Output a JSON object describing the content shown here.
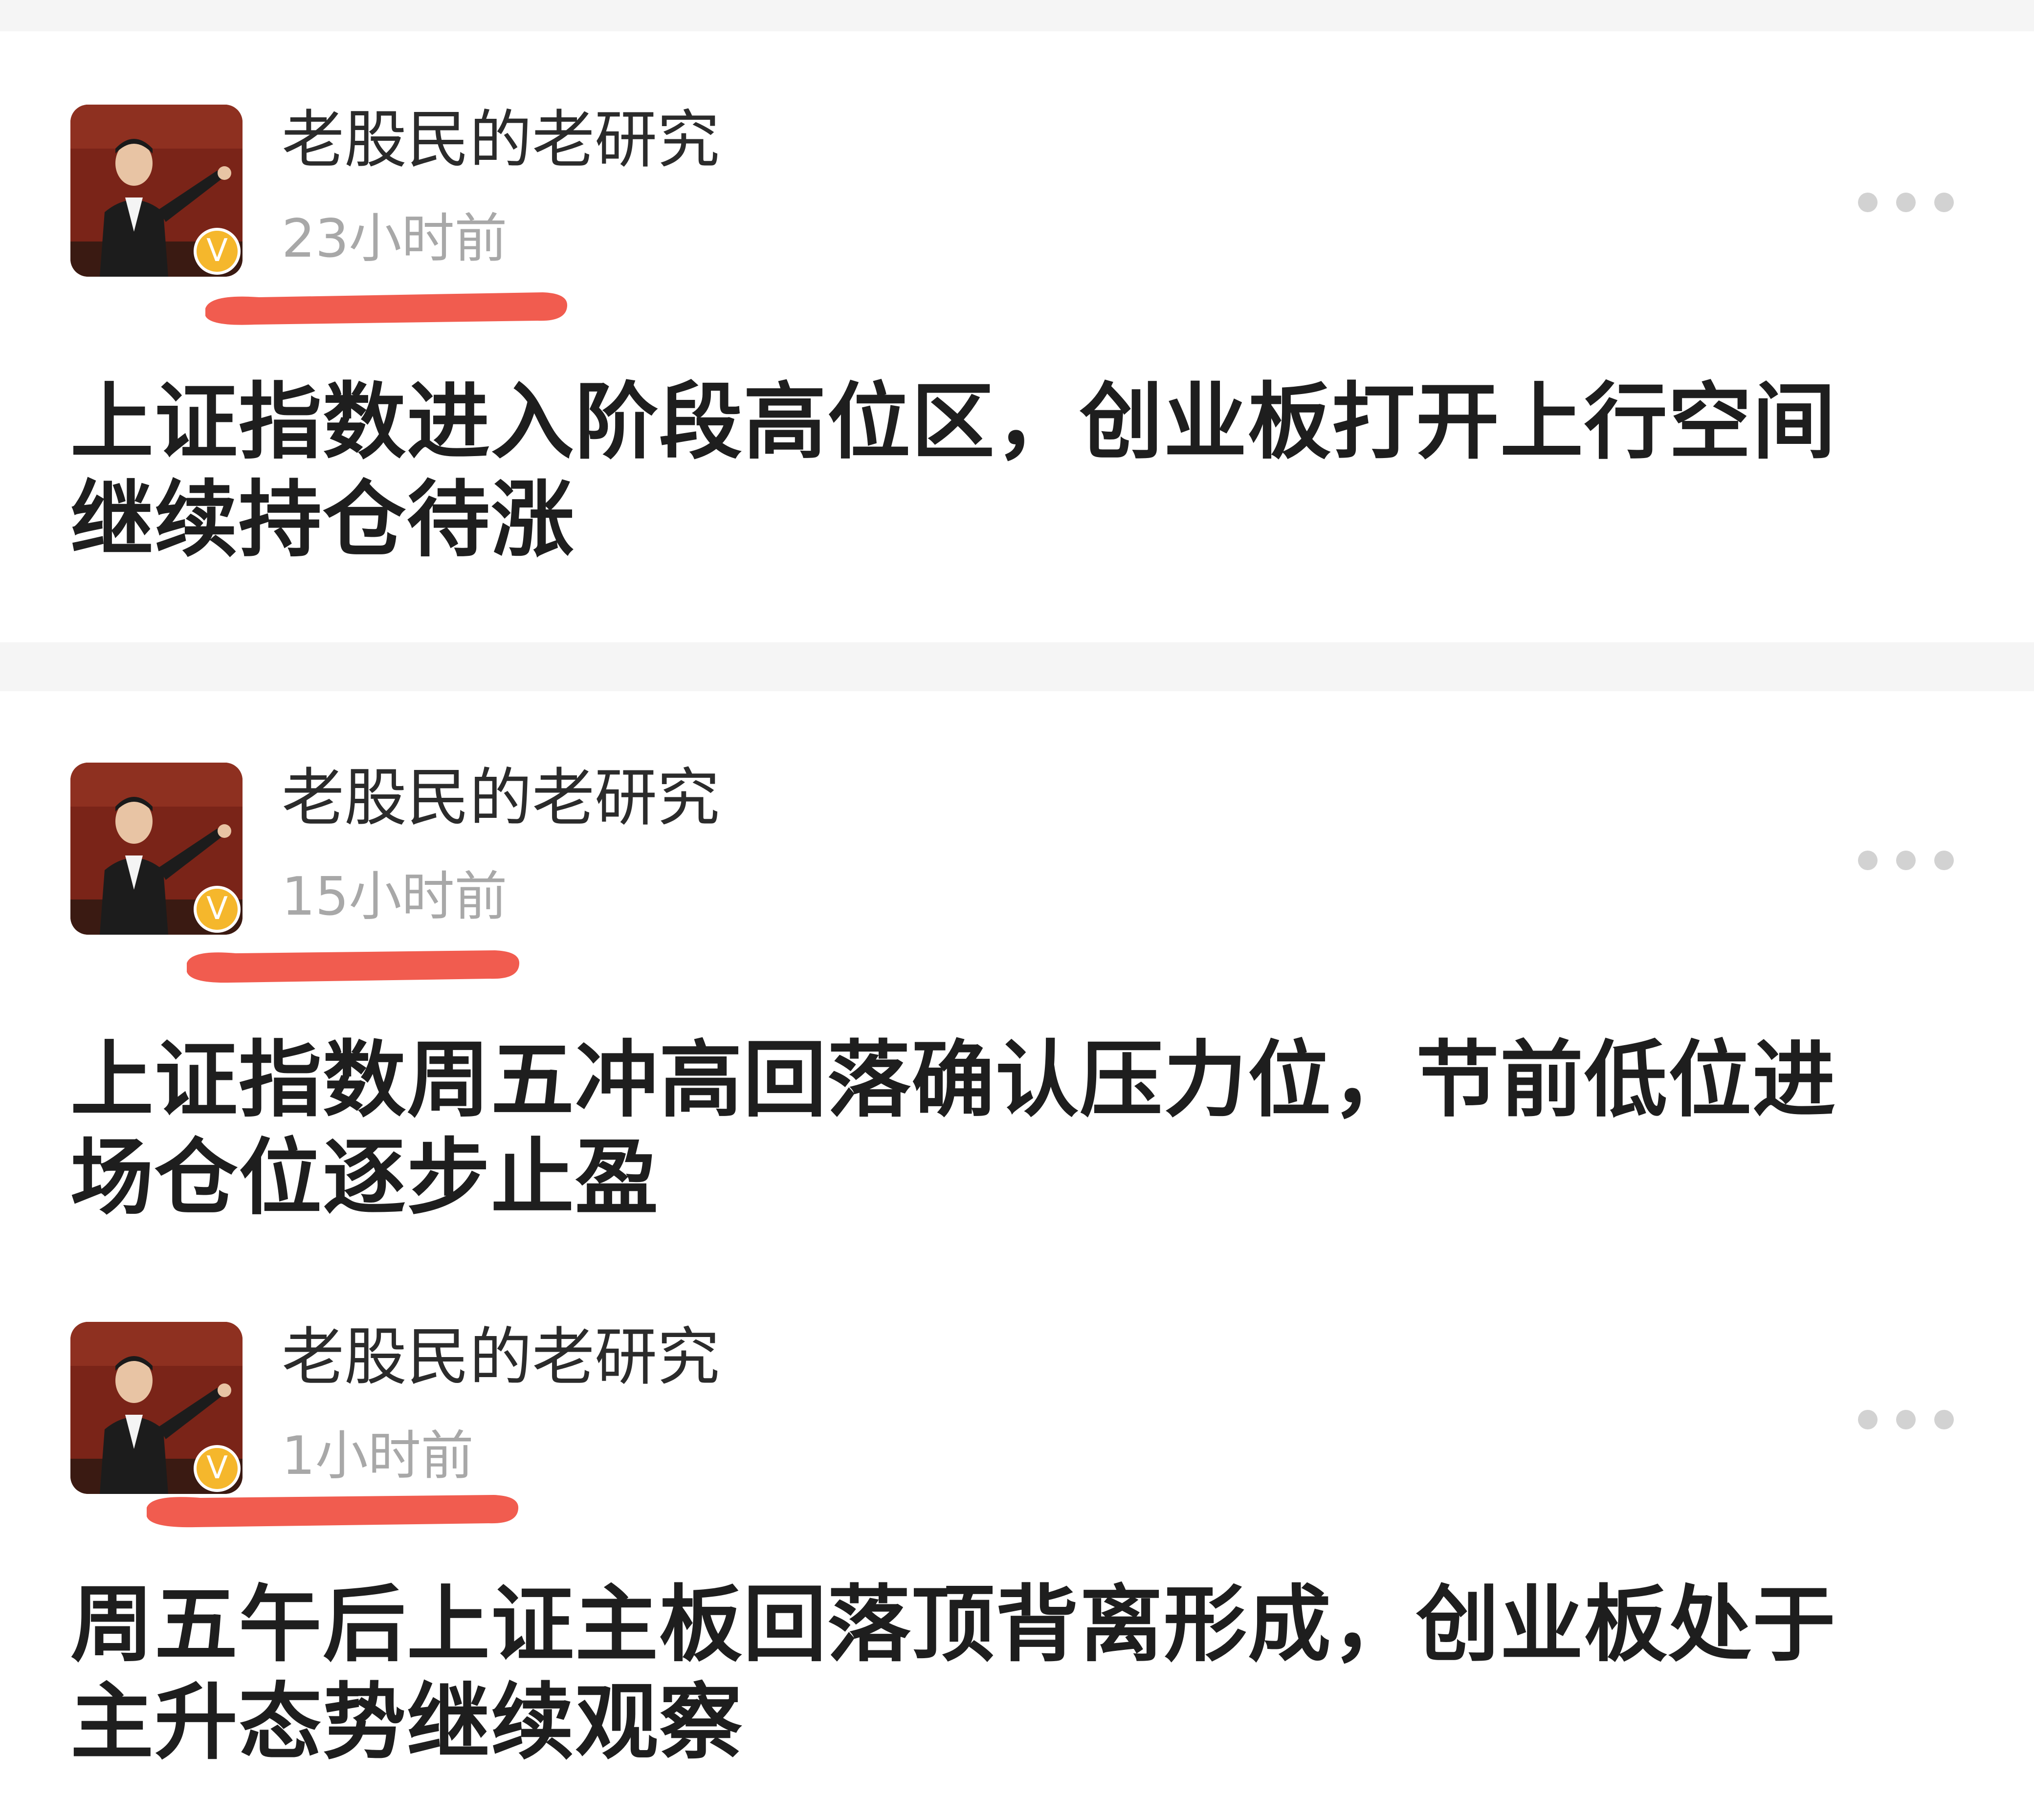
{
  "posts": [
    {
      "author": "老股民的老研究",
      "time": "23小时前",
      "title": "上证指数进入阶段高位区，创业板打开上行空间继续持仓待涨",
      "verified_badge": "V",
      "more_icon": "more-dots-icon"
    },
    {
      "author": "老股民的老研究",
      "time": "15小时前",
      "title": "上证指数周五冲高回落确认压力位，节前低位进场仓位逐步止盈",
      "verified_badge": "V",
      "more_icon": "more-dots-icon"
    },
    {
      "author": "老股民的老研究",
      "time": "1小时前",
      "title": "周五午后上证主板回落顶背离形成，创业板处于主升态势继续观察",
      "verified_badge": "V",
      "more_icon": "more-dots-icon"
    }
  ],
  "colors": {
    "background": "#f5f5f5",
    "card": "#ffffff",
    "highlight_mark": "#ef4a3c",
    "badge": "#f5b72c",
    "time_text": "#a8a8a8"
  }
}
